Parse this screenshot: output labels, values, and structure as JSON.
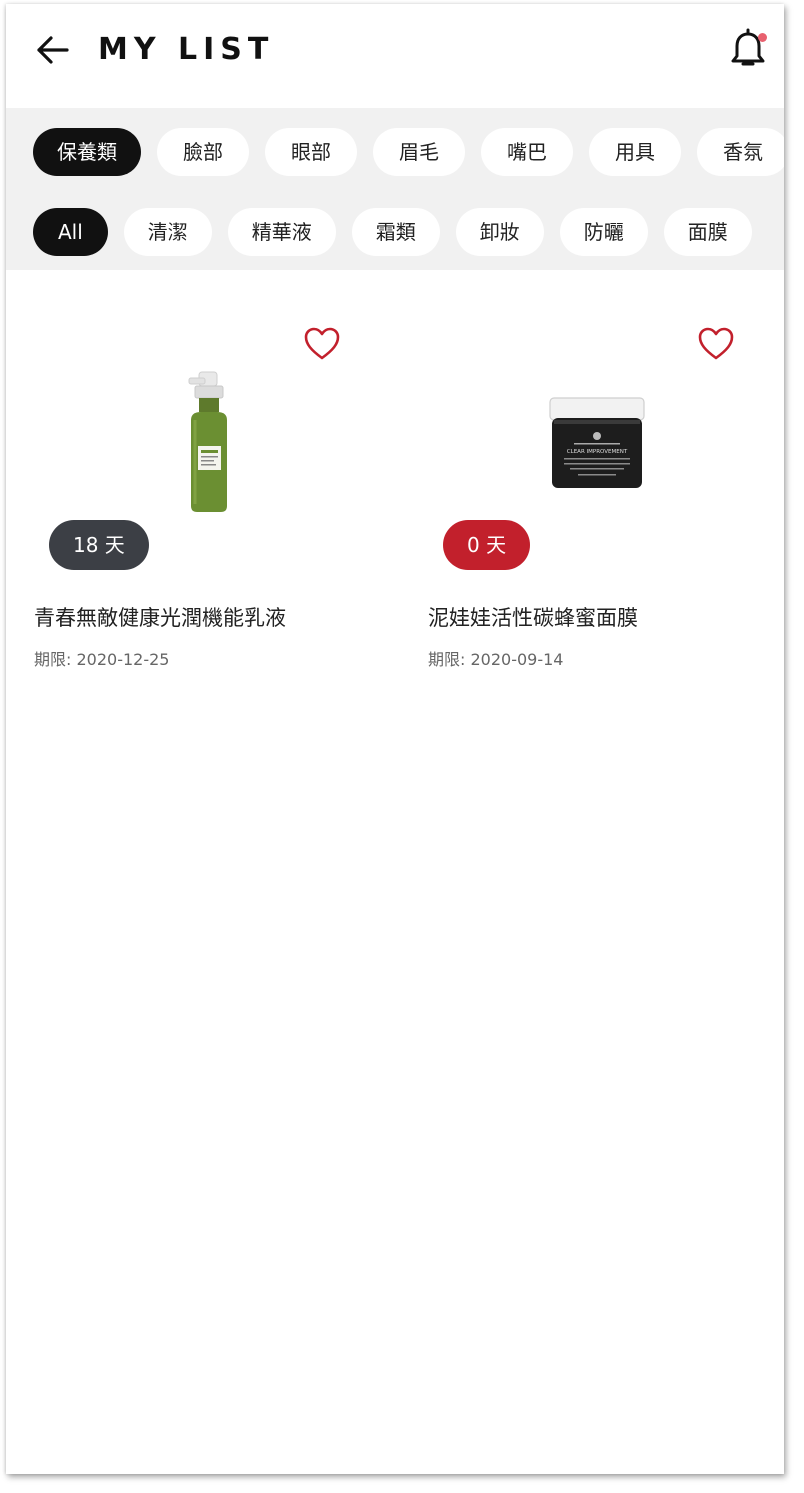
{
  "header": {
    "title": "MY LIST",
    "back_icon": "arrow-left-icon",
    "bell_icon": "bell-icon",
    "notification_dot_color": "#e8616f"
  },
  "categories": [
    "保養類",
    "臉部",
    "眼部",
    "眉毛",
    "嘴巴",
    "用具",
    "香氛"
  ],
  "subcategories": [
    "All",
    "清潔",
    "精華液",
    "霜類",
    "卸妝",
    "防曬",
    "面膜"
  ],
  "selected": {
    "category": "保養類",
    "subcategory": "All"
  },
  "products": [
    {
      "name": "青春無敵健康光潤機能乳液",
      "expiry": "期限: 2020-12-25",
      "days_left": "18 天",
      "badge_color": "#3c3f45",
      "image": "green-pump-bottle"
    },
    {
      "name": "泥娃娃活性碳蜂蜜面膜",
      "expiry": "期限: 2020-09-14",
      "days_left": "0 天",
      "badge_color": "#c2202c",
      "image": "black-jar",
      "jar_label": "CLEAR IMPROVEMENT"
    }
  ],
  "colors": {
    "active_chip": "#111111",
    "favorite_heart": "#c2202c",
    "filter_background": "#f1f1f1"
  }
}
